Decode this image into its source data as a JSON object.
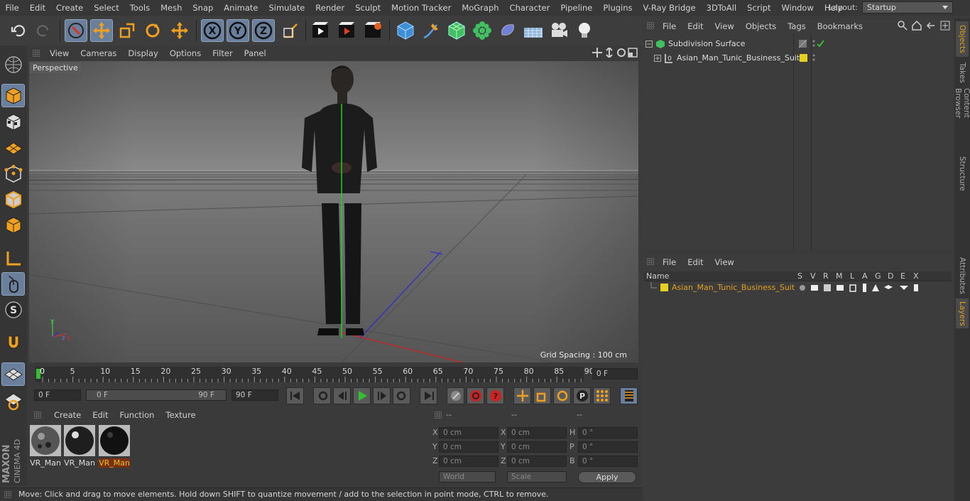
{
  "menu": [
    "File",
    "Edit",
    "Create",
    "Select",
    "Tools",
    "Mesh",
    "Snap",
    "Animate",
    "Simulate",
    "Render",
    "Sculpt",
    "Motion Tracker",
    "MoGraph",
    "Character",
    "Pipeline",
    "Plugins",
    "V-Ray Bridge",
    "3DToAll",
    "Script",
    "Window",
    "Help"
  ],
  "layout": {
    "label": "Layout:",
    "value": "Startup"
  },
  "toolbar_icons": [
    "undo-icon",
    "redo-icon",
    "live-selection-icon",
    "move-icon",
    "scale-icon",
    "rotate-icon",
    "recent-tool-icon",
    "x-axis-icon",
    "y-axis-icon",
    "z-axis-icon",
    "coordinate-system-icon",
    "render-view-icon",
    "render-picture-viewer-icon",
    "render-settings-icon",
    "cube-icon",
    "pen-icon",
    "subdivision-icon",
    "cloner-icon",
    "deformer-icon",
    "floor-icon",
    "camera-icon",
    "light-icon"
  ],
  "viewport": {
    "menu": [
      "View",
      "Cameras",
      "Display",
      "Options",
      "Filter",
      "Panel"
    ],
    "label": "Perspective",
    "grid_spacing": "Grid Spacing : 100 cm"
  },
  "timeline": {
    "ticks": [
      "0",
      "5",
      "10",
      "15",
      "20",
      "25",
      "30",
      "35",
      "40",
      "45",
      "50",
      "55",
      "60",
      "65",
      "70",
      "75",
      "80",
      "85",
      "90"
    ],
    "current": "0 F"
  },
  "transport": {
    "start": "0 F",
    "range_start": "0 F",
    "range_end": "90 F",
    "end": "90 F"
  },
  "materials": {
    "menu": [
      "Create",
      "Edit",
      "Function",
      "Texture"
    ],
    "items": [
      {
        "label": "VR_Man"
      },
      {
        "label": "VR_Man"
      },
      {
        "label": "VR_Man",
        "selected": true
      }
    ]
  },
  "coords": {
    "headers": [
      "--",
      "--",
      "--"
    ],
    "rows": [
      {
        "a": "X",
        "av": "0 cm",
        "b": "X",
        "bv": "0 cm",
        "c": "H",
        "cv": "0 °"
      },
      {
        "a": "Y",
        "av": "0 cm",
        "b": "Y",
        "bv": "0 cm",
        "c": "P",
        "cv": "0 °"
      },
      {
        "a": "Z",
        "av": "0 cm",
        "b": "Z",
        "bv": "0 cm",
        "c": "B",
        "cv": "0 °"
      }
    ],
    "world": "World",
    "scale": "Scale",
    "apply": "Apply"
  },
  "status": "Move: Click and drag to move elements. Hold down SHIFT to quantize movement / add to the selection in point mode, CTRL to remove.",
  "objects": {
    "menu": [
      "File",
      "Edit",
      "View",
      "Objects",
      "Tags",
      "Bookmarks"
    ],
    "items": [
      "Subdivision Surface",
      "Asian_Man_Tunic_Business_Suit"
    ]
  },
  "layers": {
    "menu": [
      "File",
      "Edit",
      "View"
    ],
    "columns": [
      "Name",
      "S",
      "V",
      "R",
      "M",
      "L",
      "A",
      "G",
      "D",
      "E",
      "X"
    ],
    "item": "Asian_Man_Tunic_Business_Suit"
  },
  "right_tabs": [
    "Objects",
    "Takes",
    "Content Browser",
    "Structure",
    "Attributes",
    "Layers"
  ],
  "brand": {
    "maxon": "MAXON",
    "c4d": "CINEMA 4D"
  },
  "colors": {
    "accent": "#e0a020",
    "layer": "#e8d020",
    "toolhl": "#6a7f9c"
  }
}
